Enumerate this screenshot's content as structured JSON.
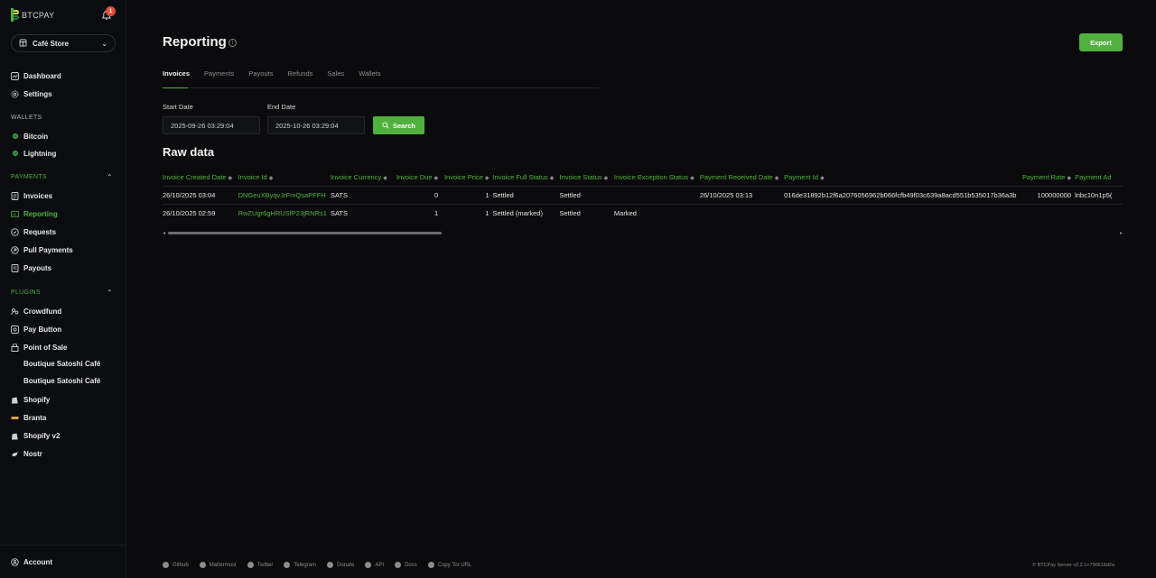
{
  "app": {
    "logo_text": "BTCPAY",
    "notifications": "1"
  },
  "store": {
    "name": "Café Store"
  },
  "nav": {
    "dashboard": "Dashboard",
    "settings": "Settings",
    "wallets_header": "WALLETS",
    "bitcoin": "Bitcoin",
    "lightning": "Lightning",
    "payments_header": "PAYMENTS",
    "invoices": "Invoices",
    "reporting": "Reporting",
    "requests": "Requests",
    "pull_payments": "Pull Payments",
    "payouts": "Payouts",
    "plugins_header": "PLUGINS",
    "crowdfund": "Crowdfund",
    "pay_button": "Pay Button",
    "point_of_sale": "Point of Sale",
    "pos_item_1": "Boutique Satoshi Café",
    "pos_item_2": "Boutique Satoshi Café",
    "shopify": "Shopify",
    "branta": "Branta",
    "shopify_v2": "Shopify v2",
    "nostr": "Nostr",
    "account": "Account"
  },
  "page": {
    "title": "Reporting",
    "export_label": "Export",
    "tabs": [
      "Invoices",
      "Payments",
      "Payouts",
      "Refunds",
      "Sales",
      "Wallets"
    ],
    "start_date_label": "Start Date",
    "end_date_label": "End Date",
    "start_date": "2025-09-26 03:29:04",
    "end_date": "2025-10-26 03:29:04",
    "search_label": "Search",
    "raw_title": "Raw data"
  },
  "table": {
    "headers": [
      "Invoice Created Date",
      "Invoice Id",
      "Invoice Currency",
      "Invoice Due",
      "Invoice Price",
      "Invoice Full Status",
      "Invoice Status",
      "Invoice Exception Status",
      "Payment Received Date",
      "Payment Id",
      "Payment Rate",
      "Payment Ad"
    ],
    "rows": [
      [
        "26/10/2025 03:04",
        "DNGeuXByqvJrFmQsaPFFH",
        "SATS",
        "0",
        "1",
        "Settled",
        "Settled",
        "",
        "26/10/2025 03:13",
        "016de31892b12f6a2076056962b066fcfb49f03c639a8acd551b535017b36a3b",
        "100000000",
        "lnbc10n1p5("
      ],
      [
        "26/10/2025 02:59",
        "RwZUgr6gHRUSfP23jRNRs1",
        "SATS",
        "1",
        "1",
        "Settled (marked)",
        "Settled",
        "Marked",
        "",
        "",
        "",
        ""
      ]
    ]
  },
  "footer": {
    "links": [
      "Github",
      "Mattermost",
      "Twitter",
      "Telegram",
      "Donate",
      "API",
      "Docs",
      "Copy Tor URL"
    ],
    "copyright": "© BTCPay Server v2.2.1+790616d2a"
  },
  "colors": {
    "accent": "#51b13e",
    "background": "#0b0b0d",
    "sidebar": "#0a0c10"
  }
}
